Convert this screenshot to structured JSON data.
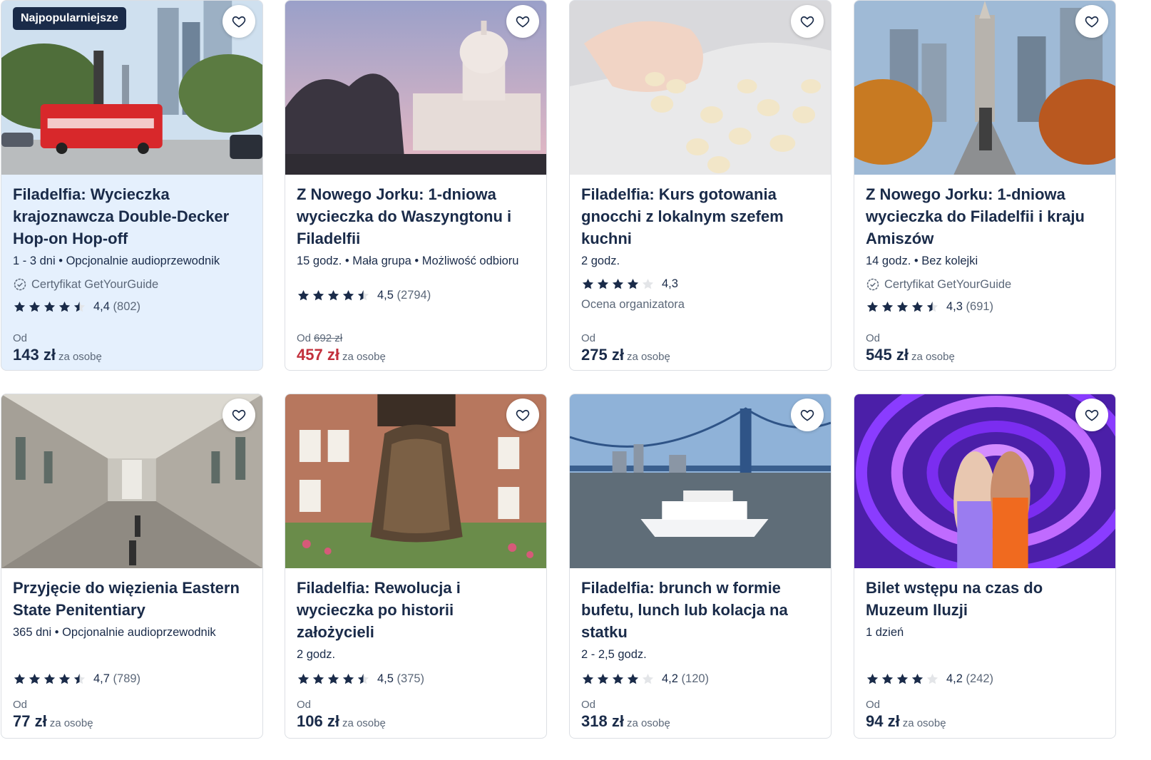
{
  "colors": {
    "text": "#1a2b49",
    "muted": "#5c6879",
    "sale": "#c2303c",
    "highlight": "#e5f0fd",
    "star": "#1a2b49"
  },
  "badge_popular": "Najpopularniejsze",
  "cert_label": "Certyfikat GetYourGuide",
  "from_label": "Od",
  "per_person": "za osobę",
  "cards": [
    {
      "title": "Filadelfia: Wycieczka krajoznawcza Double-Decker Hop-on Hop-off",
      "meta": "1 - 3 dni • Opcjonalnie audioprzewodnik",
      "rating": "4,4",
      "stars": 4.5,
      "count": "(802)",
      "price": "143 zł"
    },
    {
      "title": "Z Nowego Jorku: 1-dniowa wycieczka do Waszyngtonu i Filadelfii",
      "meta": "15 godz. • Mała grupa • Możliwość odbioru",
      "rating": "4,5",
      "stars": 4.5,
      "count": "(2794)",
      "old_price": "692 zł",
      "price": "457 zł"
    },
    {
      "title": "Filadelfia: Kurs gotowania gnocchi z lokalnym szefem kuchni",
      "meta": "2 godz.",
      "rating": "4,3",
      "stars": 4,
      "count": "",
      "org_note": "Ocena organizatora",
      "price": "275 zł"
    },
    {
      "title": "Z Nowego Jorku: 1-dniowa wycieczka do Filadelfii i kraju Amiszów",
      "meta": "14 godz. • Bez kolejki",
      "rating": "4,3",
      "stars": 4.5,
      "count": "(691)",
      "price": "545 zł"
    },
    {
      "title": "Przyjęcie do więzienia Eastern State Penitentiary",
      "meta": "365 dni • Opcjonalnie audioprzewodnik",
      "rating": "4,7",
      "stars": 4.5,
      "count": "(789)",
      "price": "77 zł"
    },
    {
      "title": "Filadelfia: Rewolucja i wycieczka po historii założycieli",
      "meta": "2 godz.",
      "rating": "4,5",
      "stars": 4.5,
      "count": "(375)",
      "price": "106 zł"
    },
    {
      "title": "Filadelfia: brunch w formie bufetu, lunch lub kolacja na statku",
      "meta": "2 - 2,5 godz.",
      "rating": "4,2",
      "stars": 4,
      "count": "(120)",
      "price": "318 zł"
    },
    {
      "title": "Bilet wstępu na czas do Muzeum Iluzji",
      "meta": "1 dzień",
      "rating": "4,2",
      "stars": 4,
      "count": "(242)",
      "price": "94 zł"
    }
  ]
}
